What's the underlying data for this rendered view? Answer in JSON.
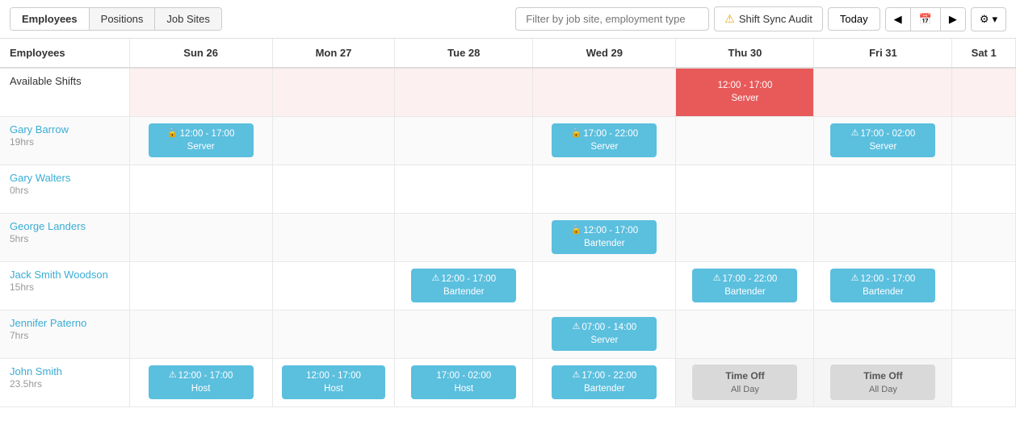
{
  "toolbar": {
    "tabs": [
      {
        "label": "Employees",
        "active": true
      },
      {
        "label": "Positions",
        "active": false
      },
      {
        "label": "Job Sites",
        "active": false
      }
    ],
    "filter_placeholder": "Filter by job site, employment type",
    "audit_label": "Shift Sync Audit",
    "today_label": "Today",
    "prev_icon": "◀",
    "cal_icon": "📅",
    "next_icon": "▶",
    "settings_icon": "⚙"
  },
  "header": {
    "col_employee": "Employees",
    "days": [
      {
        "label": "Sun 26"
      },
      {
        "label": "Mon 27"
      },
      {
        "label": "Tue 28"
      },
      {
        "label": "Wed 29"
      },
      {
        "label": "Thu 30"
      },
      {
        "label": "Fri 31"
      },
      {
        "label": "Sat 1"
      }
    ]
  },
  "available_row": {
    "label": "Available Shifts",
    "shifts": [
      {
        "day": 0,
        "time": null,
        "role": null,
        "type": null
      },
      {
        "day": 1,
        "time": null,
        "role": null,
        "type": null
      },
      {
        "day": 2,
        "time": null,
        "role": null,
        "type": null
      },
      {
        "day": 3,
        "time": null,
        "role": null,
        "type": null
      },
      {
        "day": 4,
        "time": "12:00 - 17:00",
        "role": "Server",
        "type": "red"
      },
      {
        "day": 5,
        "time": null,
        "role": null,
        "type": null
      },
      {
        "day": 6,
        "time": null,
        "role": null,
        "type": null
      }
    ]
  },
  "employees": [
    {
      "name": "Gary Barrow",
      "hours": "19hrs",
      "shifts": [
        {
          "day": 0,
          "time": "12:00 - 17:00",
          "role": "Server",
          "type": "lock"
        },
        {
          "day": 1,
          "time": null,
          "role": null,
          "type": null
        },
        {
          "day": 2,
          "time": null,
          "role": null,
          "type": null
        },
        {
          "day": 3,
          "time": "17:00 - 22:00",
          "role": "Server",
          "type": "lock"
        },
        {
          "day": 4,
          "time": null,
          "role": null,
          "type": null
        },
        {
          "day": 5,
          "time": "17:00 - 02:00",
          "role": "Server",
          "type": "warning"
        },
        {
          "day": 6,
          "time": null,
          "role": null,
          "type": null
        }
      ]
    },
    {
      "name": "Gary Walters",
      "hours": "0hrs",
      "shifts": [
        {
          "day": 0,
          "time": null
        },
        {
          "day": 1,
          "time": null
        },
        {
          "day": 2,
          "time": null
        },
        {
          "day": 3,
          "time": null
        },
        {
          "day": 4,
          "time": null
        },
        {
          "day": 5,
          "time": null
        },
        {
          "day": 6,
          "time": null
        }
      ]
    },
    {
      "name": "George Landers",
      "hours": "5hrs",
      "shifts": [
        {
          "day": 0,
          "time": null
        },
        {
          "day": 1,
          "time": null
        },
        {
          "day": 2,
          "time": null
        },
        {
          "day": 3,
          "time": "12:00 - 17:00",
          "role": "Bartender",
          "type": "lock"
        },
        {
          "day": 4,
          "time": null
        },
        {
          "day": 5,
          "time": null
        },
        {
          "day": 6,
          "time": null
        }
      ]
    },
    {
      "name": "Jack Smith Woodson",
      "hours": "15hrs",
      "shifts": [
        {
          "day": 0,
          "time": null
        },
        {
          "day": 1,
          "time": null
        },
        {
          "day": 2,
          "time": "12:00 - 17:00",
          "role": "Bartender",
          "type": "warning"
        },
        {
          "day": 3,
          "time": null
        },
        {
          "day": 4,
          "time": "17:00 - 22:00",
          "role": "Bartender",
          "type": "warning"
        },
        {
          "day": 5,
          "time": "12:00 - 17:00",
          "role": "Bartender",
          "type": "warning"
        },
        {
          "day": 6,
          "time": null
        }
      ]
    },
    {
      "name": "Jennifer Paterno",
      "hours": "7hrs",
      "shifts": [
        {
          "day": 0,
          "time": null
        },
        {
          "day": 1,
          "time": null
        },
        {
          "day": 2,
          "time": null
        },
        {
          "day": 3,
          "time": "07:00 - 14:00",
          "role": "Server",
          "type": "warning"
        },
        {
          "day": 4,
          "time": null
        },
        {
          "day": 5,
          "time": null
        },
        {
          "day": 6,
          "time": null
        }
      ]
    },
    {
      "name": "John Smith",
      "hours": "23.5hrs",
      "shifts": [
        {
          "day": 0,
          "time": "12:00 - 17:00",
          "role": "Host",
          "type": "warning"
        },
        {
          "day": 1,
          "time": "12:00 - 17:00",
          "role": "Host",
          "type": "plain"
        },
        {
          "day": 2,
          "time": "17:00 - 02:00",
          "role": "Host",
          "type": "plain"
        },
        {
          "day": 3,
          "time": "17:00 - 22:00",
          "role": "Bartender",
          "type": "warning"
        },
        {
          "day": 4,
          "time": null,
          "role": null,
          "type": "timeoff"
        },
        {
          "day": 5,
          "time": null,
          "role": null,
          "type": "timeoff"
        },
        {
          "day": 6,
          "time": null
        }
      ]
    }
  ],
  "timeoff_label": "Time Off",
  "timeoff_sub": "All Day"
}
